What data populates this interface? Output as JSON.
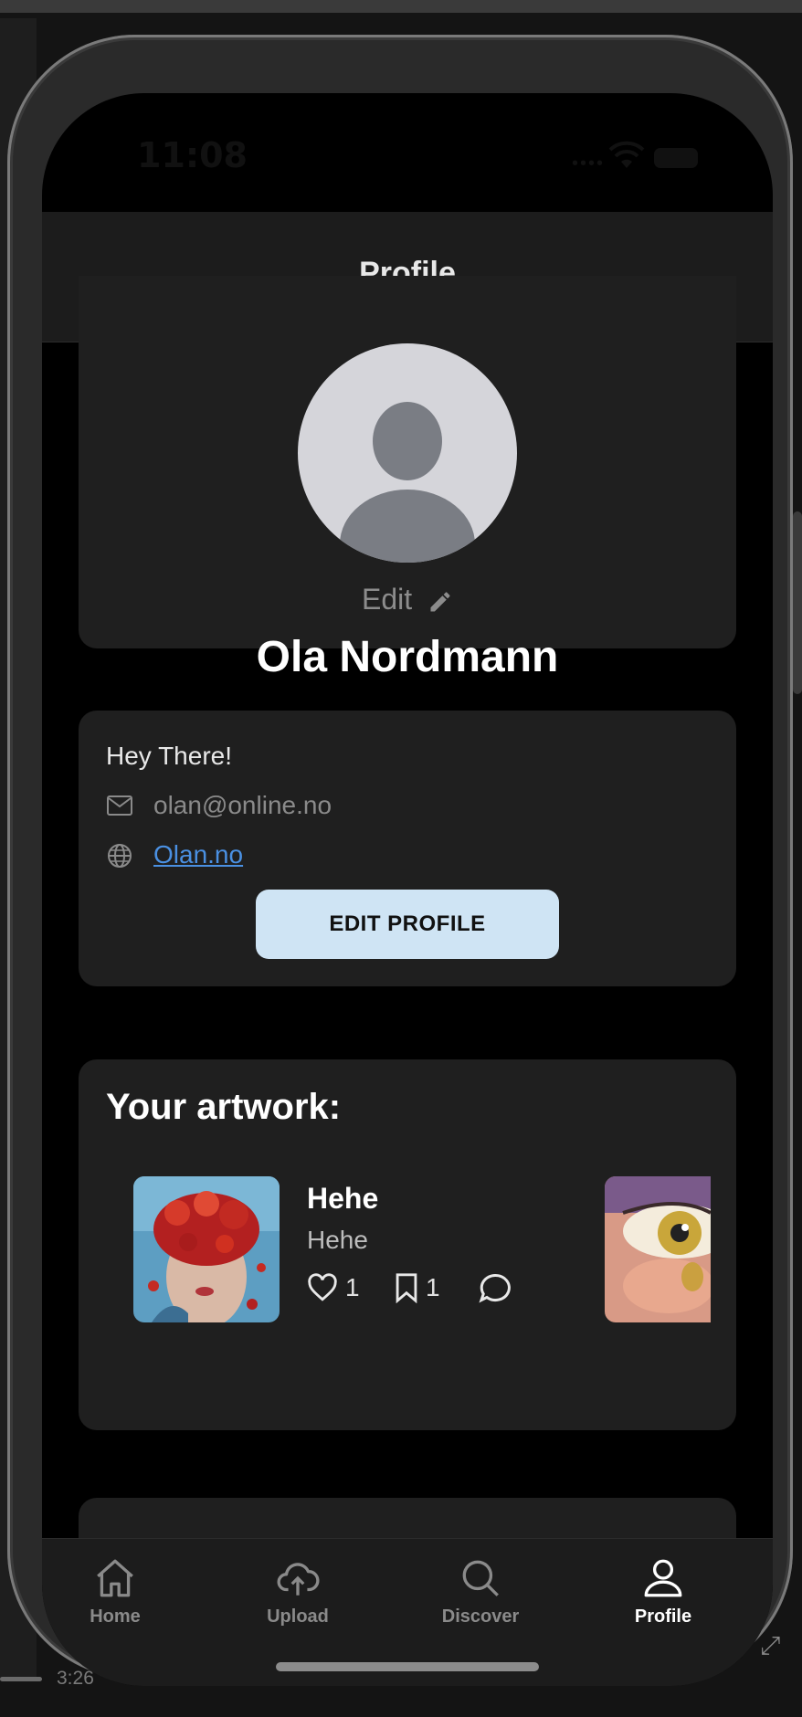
{
  "status_bar": {
    "time": "11:08"
  },
  "header": {
    "title": "Profile"
  },
  "profile": {
    "edit_label": "Edit",
    "name": "Ola Nordmann"
  },
  "info": {
    "bio": "Hey There!",
    "email": "olan@online.no",
    "website": "Olan.no",
    "edit_button": "EDIT PROFILE"
  },
  "artwork": {
    "title": "Your artwork:",
    "items": [
      {
        "title": "Hehe",
        "subtitle": "Hehe",
        "likes": "1",
        "saves": "1"
      }
    ]
  },
  "tabbar": {
    "tabs": [
      {
        "label": "Home",
        "icon": "home-icon",
        "active": false
      },
      {
        "label": "Upload",
        "icon": "cloud-upload-icon",
        "active": false
      },
      {
        "label": "Discover",
        "icon": "search-icon",
        "active": false
      },
      {
        "label": "Profile",
        "icon": "person-icon",
        "active": true
      }
    ]
  },
  "background": {
    "time": "3:26"
  },
  "colors": {
    "accent_button": "#cfe4f4",
    "link": "#4a90e2",
    "card": "#1f1f1f",
    "background": "#000000"
  }
}
